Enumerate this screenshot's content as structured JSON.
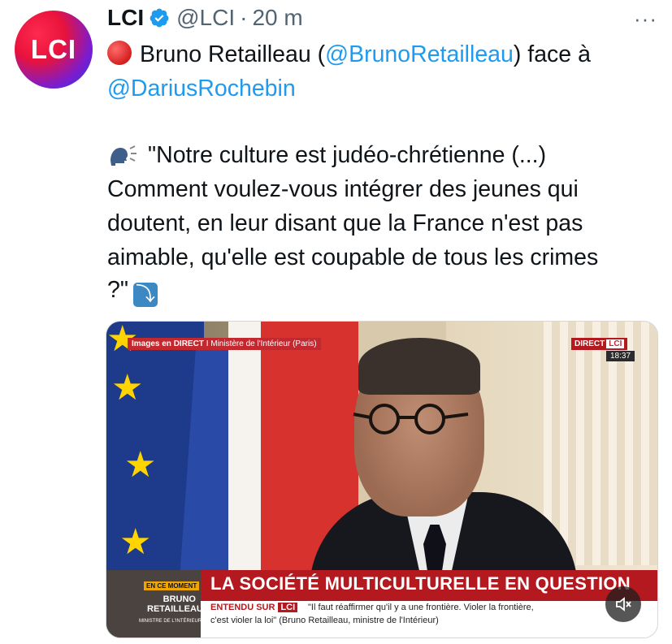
{
  "account": {
    "avatar_text": "LCI",
    "name": "LCI",
    "handle": "@LCI",
    "separator": "·",
    "time": "20 m"
  },
  "more_label": "···",
  "tweet": {
    "line1_text": "Bruno Retailleau (",
    "line1_mention": "@BrunoRetailleau",
    "line1_end": ") face à",
    "line2_mention": "@DariusRochebin",
    "quote_line1": "\"Notre culture est judéo-chrétienne (...)",
    "quote_line2": "Comment voulez-vous intégrer des jeunes qui",
    "quote_line3": "doutent, en leur disant que la France n'est pas",
    "quote_line4": "aimable, qu'elle est coupable de tous les crimes",
    "quote_line5": "?\"",
    "arrow_glyph": "⤵"
  },
  "video": {
    "live_tag": "Images en DIRECT",
    "live_location": "I  Ministère de l'Intérieur (Paris)",
    "direct_label": "DIRECT",
    "direct_brand": "LCI",
    "clock": "18:37",
    "thumb_tag": "EN CE MOMENT",
    "thumb_name": "BRUNO RETAILLEAU",
    "thumb_role": "MINISTRE DE L'INTÉRIEUR",
    "banner_title": "LA SOCIÉTÉ MULTICULTURELLE EN QUESTION",
    "entendu_label": "ENTENDU SUR",
    "entendu_brand": "LCI",
    "quote_line1": "\"Il faut réaffirmer qu'il y a une frontière. Violer la frontière,",
    "quote_line2": "c'est violer la loi\" (Bruno Retailleau, ministre de l'Intérieur)"
  },
  "colors": {
    "mention": "#1d9bf0",
    "verified": "#1d9bf0",
    "banner_red": "#b3191f"
  },
  "icons": [
    "verified-badge-icon",
    "more-icon",
    "red-circle-icon",
    "speaking-head-icon",
    "arrow-down-right-icon",
    "mute-icon"
  ]
}
